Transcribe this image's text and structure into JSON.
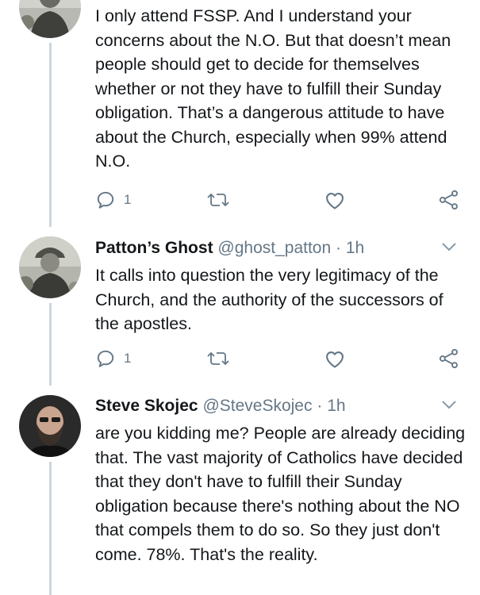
{
  "colors": {
    "text": "#14171a",
    "muted": "#657786",
    "line": "#ccd6dd"
  },
  "tweets": [
    {
      "text": "I only attend FSSP. And I understand your concerns about the N.O. But that doesn’t mean people should get to decide for themselves whether or not they have to fulfill their Sunday obligation. That’s a dangerous attitude to have about the Church, especially when 99% attend N.O.",
      "reply_count": "1",
      "avatar_icon": "soldier-avatar"
    },
    {
      "name": "Patton’s Ghost",
      "handle": "@ghost_patton",
      "separator": "·",
      "time": "1h",
      "text": "It calls into question the very legitimacy of the Church, and the authority of the successors of the apostles.",
      "reply_count": "1",
      "avatar_icon": "soldier-avatar"
    },
    {
      "name": "Steve Skojec",
      "handle": "@SteveSkojec",
      "separator": "·",
      "time": "1h",
      "text": "are you kidding me? People are already deciding that. The vast majority of Catholics have decided that they don't have to fulfill their Sunday obligation because there's nothing about the NO that compels them to do so. So they just don't come. 78%. That's the reality.",
      "avatar_icon": "bearded-man-avatar"
    }
  ]
}
